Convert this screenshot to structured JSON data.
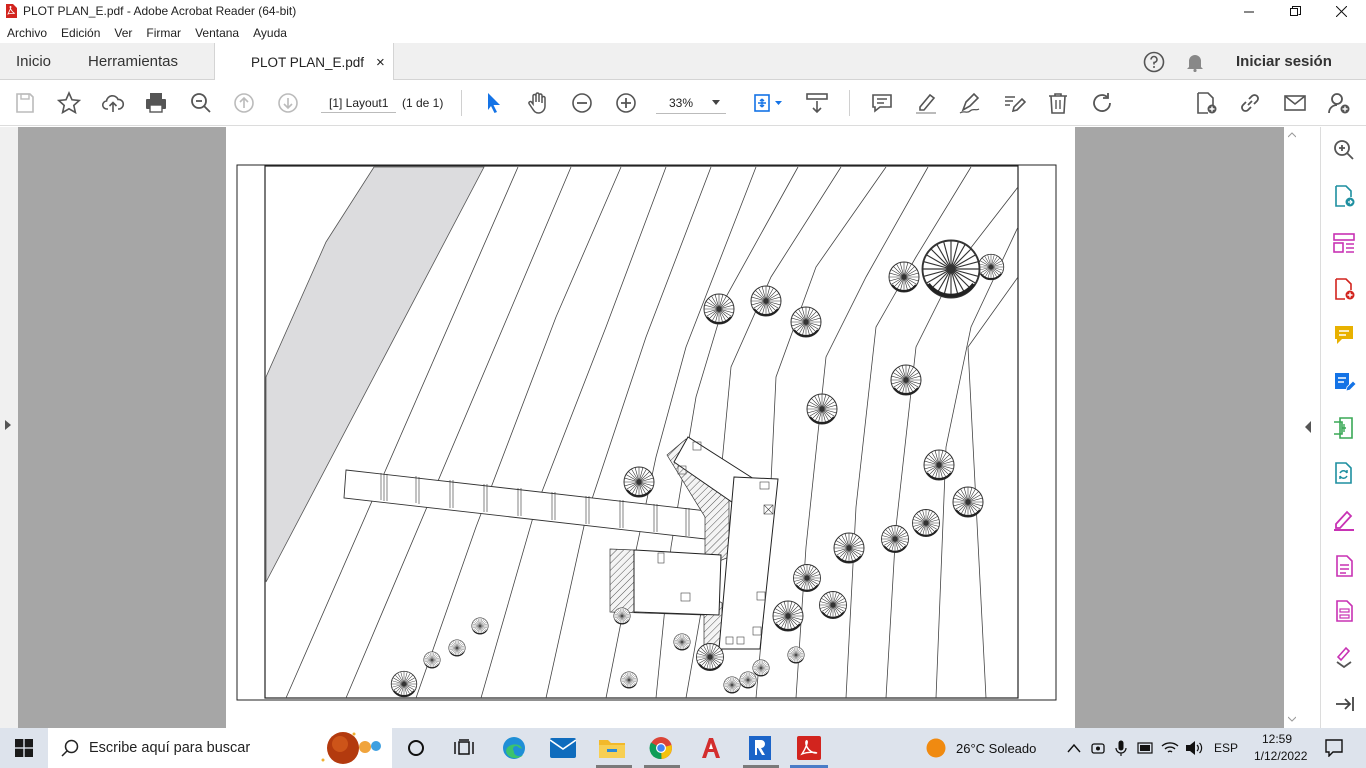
{
  "window": {
    "title": "PLOT PLAN_E.pdf - Adobe Acrobat Reader (64-bit)",
    "controls": [
      "minimize-icon",
      "restore-icon",
      "close-icon"
    ]
  },
  "menu": [
    "Archivo",
    "Edición",
    "Ver",
    "Firmar",
    "Ventana",
    "Ayuda"
  ],
  "tabs": {
    "home": "Inicio",
    "tools": "Herramientas",
    "document": "PLOT PLAN_E.pdf",
    "close_glyph": "×"
  },
  "account": {
    "signin": "Iniciar sesión"
  },
  "toolbar": {
    "page_label": "[1] Layout1",
    "page_count": "(1 de 1)",
    "zoom": "33%"
  },
  "taskbar": {
    "search_placeholder": "Escribe aquí para buscar",
    "weather": "26°C  Soleado",
    "language": "ESP",
    "time": "12:59",
    "date": "1/12/2022"
  },
  "colors": {
    "acrobat_red": "#d2241e",
    "select_blue": "#1473e6",
    "comment_yellow": "#e8b100",
    "tool_pink": "#c832b4",
    "tool_teal": "#1e8fa0",
    "tool_green": "#3aa856",
    "canvas_gray": "#a6a6a6"
  }
}
